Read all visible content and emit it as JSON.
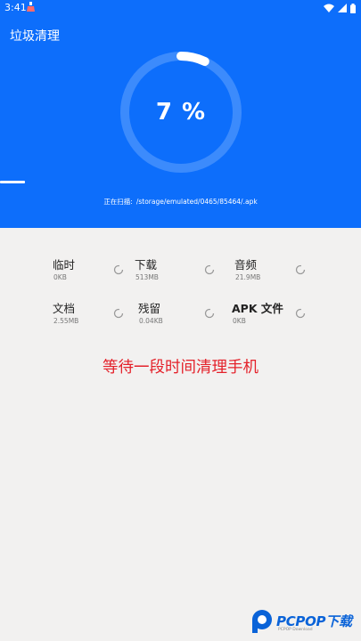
{
  "status_bar": {
    "time": "3:41",
    "icons": [
      "cleaner-notification-icon",
      "wifi-icon",
      "signal-icon",
      "battery-icon"
    ]
  },
  "header": {
    "title": "垃圾清理",
    "progress_text": "7 %",
    "progress_value": 0.07,
    "scan_label": "正在扫描:",
    "scan_path": "/storage/emulated/0465/85464/.apk"
  },
  "categories": [
    {
      "name": "临时",
      "size": "0KB"
    },
    {
      "name": "下载",
      "size": "513MB"
    },
    {
      "name": "音频",
      "size": "21.9MB"
    },
    {
      "name": "文档",
      "size": "2.55MB"
    },
    {
      "name": "残留",
      "size": "0.04KB"
    },
    {
      "name": "APK 文件",
      "size": "0KB"
    }
  ],
  "wait_message": "等待一段时间清理手机",
  "watermark": {
    "brand": "PCPOP下载",
    "sub": "PCPOP Download"
  },
  "colors": {
    "header_bg": "#0d6efb",
    "ring_track": "#3c8bfc",
    "ring_progress": "#ffffff",
    "message": "#e4212a",
    "page_bg": "#f2f1f0"
  }
}
